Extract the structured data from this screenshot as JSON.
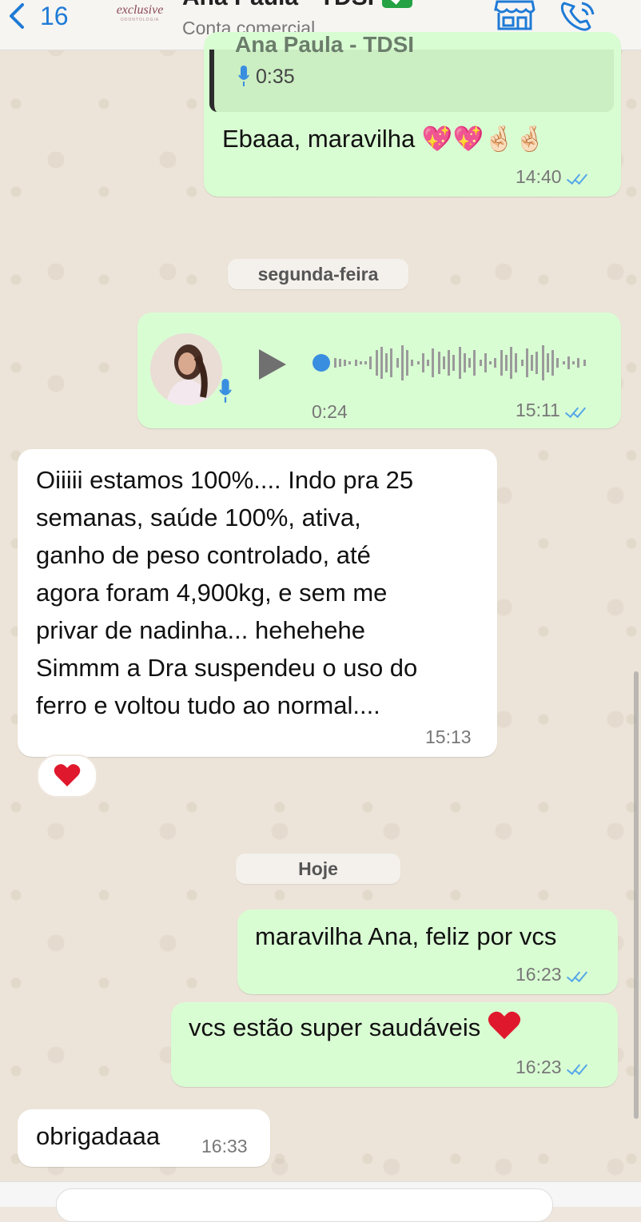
{
  "header": {
    "back_count": "16",
    "logo_text": "exclusive",
    "logo_sub": "ODONTOLOGIA",
    "contact_name": "Ana Paula - TDSI",
    "contact_sub": "Conta comercial"
  },
  "messages": {
    "m1": {
      "quoted_name": "Ana Paula - TDSI",
      "quoted_duration": "0:35",
      "text": "Ebaaa, maravilha 💖💖🤞🏻🤞🏻",
      "time": "14:40"
    },
    "day1": "segunda-feira",
    "voice": {
      "duration": "0:24",
      "time": "15:11"
    },
    "m2": {
      "lines": [
        "Oiiiii estamos 100%.... Indo pra 25",
        "semanas, saúde 100%, ativa,",
        "ganho de peso controlado, até",
        "agora foram 4,900kg, e sem me",
        "privar de nadinha... hehehehe",
        "Simmm a Dra suspendeu o uso do",
        "ferro e voltou tudo ao normal...."
      ],
      "time": "15:13",
      "reaction": "heart"
    },
    "day2": "Hoje",
    "m3": {
      "text": "maravilha Ana, feliz por vcs",
      "time": "16:23"
    },
    "m4": {
      "text": "vcs estão super saudáveis",
      "time": "16:23"
    },
    "m5": {
      "text": "obrigadaaa",
      "time": "16:33"
    }
  },
  "colors": {
    "outgoing_bubble": "#d9fdd3",
    "incoming_bubble": "#ffffff",
    "accent_blue": "#1f7bd6",
    "read_ticks": "#53a6e8",
    "verified_green": "#25a244"
  }
}
